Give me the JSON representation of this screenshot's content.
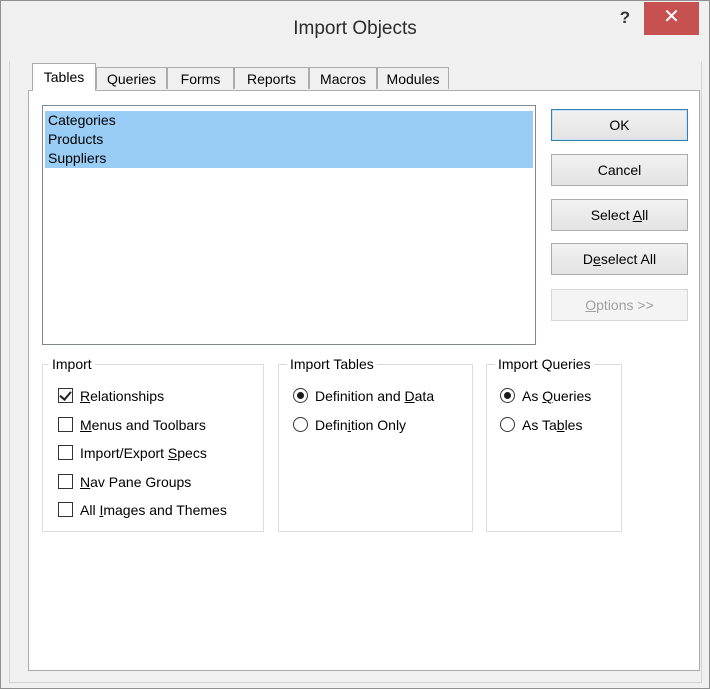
{
  "window": {
    "title": "Import Objects",
    "help_label": "?",
    "close_label": "✕"
  },
  "tabs": [
    {
      "label": "Tables",
      "active": true
    },
    {
      "label": "Queries"
    },
    {
      "label": "Forms"
    },
    {
      "label": "Reports"
    },
    {
      "label": "Macros"
    },
    {
      "label": "Modules"
    }
  ],
  "list": {
    "items": [
      "Categories",
      "Products",
      "Suppliers"
    ],
    "selected": [
      "Categories",
      "Products",
      "Suppliers"
    ]
  },
  "buttons": {
    "ok": "OK",
    "cancel": "Cancel",
    "select_all": {
      "pre": "Select ",
      "key": "A",
      "post": "ll"
    },
    "deselect_all": {
      "pre": "D",
      "key": "e",
      "post": "select All"
    },
    "options": {
      "pre": "",
      "key": "O",
      "post": "ptions >>"
    }
  },
  "import_group": {
    "title": "Import",
    "options": [
      {
        "pre": "",
        "key": "R",
        "post": "elationships",
        "checked": true
      },
      {
        "pre": "",
        "key": "M",
        "post": "enus and Toolbars",
        "checked": false
      },
      {
        "pre": "Import/Export ",
        "key": "S",
        "post": "pecs",
        "checked": false
      },
      {
        "pre": "",
        "key": "N",
        "post": "av Pane Groups",
        "checked": false
      },
      {
        "pre": "All ",
        "key": "I",
        "post": "mages and Themes",
        "checked": false
      }
    ]
  },
  "import_tables_group": {
    "title": "Import Tables",
    "options": [
      {
        "pre": "Definition and ",
        "key": "D",
        "post": "ata",
        "selected": true
      },
      {
        "pre": "Defin",
        "key": "i",
        "post": "tion Only",
        "selected": false
      }
    ]
  },
  "import_queries_group": {
    "title": "Import Queries",
    "options": [
      {
        "pre": "As ",
        "key": "Q",
        "post": "ueries",
        "selected": true
      },
      {
        "pre": "As Ta",
        "key": "b",
        "post": "les",
        "selected": false
      }
    ]
  },
  "colors": {
    "selection": "#99cdf6",
    "close_button": "#c75050",
    "default_button_border": "#3c7fb1"
  }
}
